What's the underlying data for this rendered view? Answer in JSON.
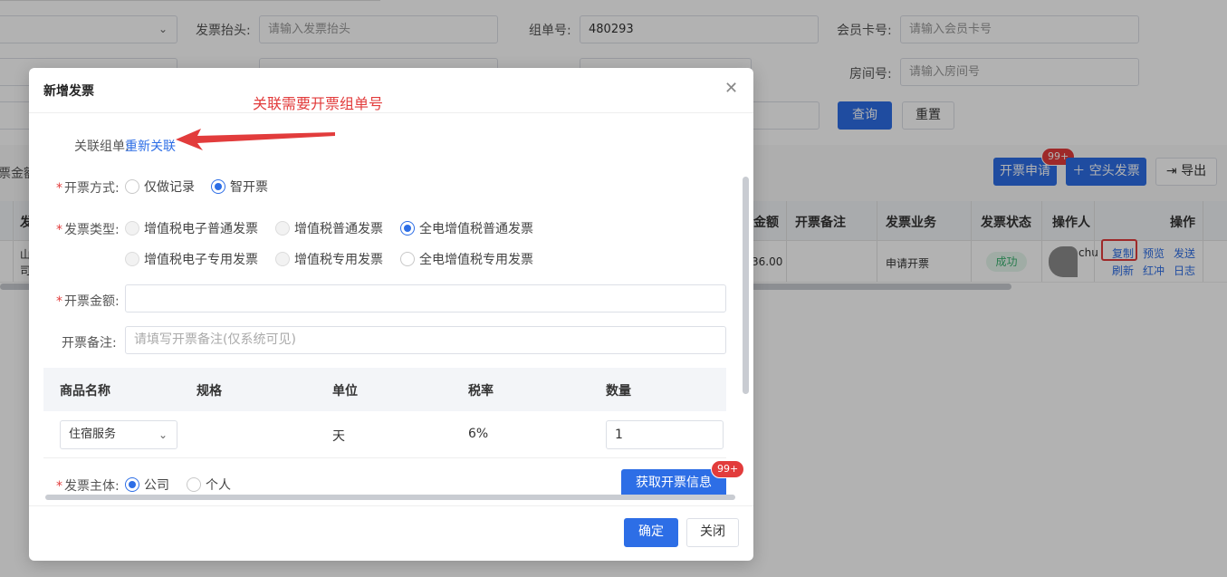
{
  "filters": {
    "invoice_title_label": "发票抬头:",
    "invoice_title_placeholder": "请输入发票抬头",
    "group_no_label": "组单号:",
    "group_no_value": "480293",
    "member_card_label": "会员卡号:",
    "member_card_placeholder": "请输入会员卡号",
    "room_no_label": "房间号:",
    "room_no_placeholder": "请输入房间号",
    "query_button": "查询",
    "reset_button": "重置"
  },
  "toolbar": {
    "amount_partial": "票金额",
    "apply_invoice": "开票申请",
    "apply_badge": "99+",
    "blank_invoice": "空头发票",
    "export": "导出"
  },
  "table": {
    "headers": {
      "first_partial": "发",
      "amount_partial": "金额",
      "note": "开票备注",
      "business": "发票业务",
      "status": "发票状态",
      "operator": "操作人",
      "actions": "操作"
    },
    "row": {
      "first_line1": "山",
      "first_line2": "司",
      "amount": "36.00",
      "business": "申请开票",
      "status": "成功",
      "operator_partial": "chu",
      "actions": [
        "复制",
        "预览",
        "发送",
        "刷新",
        "红冲",
        "日志"
      ]
    }
  },
  "modal": {
    "title": "新增发票",
    "related_order_label": "关联组单:",
    "related_order_link": "重新关联",
    "method_label": "开票方式:",
    "method_options": [
      "仅做记录",
      "智开票"
    ],
    "method_selected": "智开票",
    "type_label": "发票类型:",
    "type_options_row1": [
      "增值税电子普通发票",
      "增值税普通发票",
      "全电增值税普通发票"
    ],
    "type_options_row2": [
      "增值税电子专用发票",
      "增值税专用发票",
      "全电增值税专用发票"
    ],
    "type_selected": "全电增值税普通发票",
    "amount_label": "开票金额:",
    "amount_value": "",
    "remark_label": "开票备注:",
    "remark_placeholder": "请填写开票备注(仅系统可见)",
    "goods_table": {
      "headers": [
        "商品名称",
        "规格",
        "单位",
        "税率",
        "数量"
      ],
      "row": {
        "name": "住宿服务",
        "spec": "",
        "unit": "天",
        "tax_rate": "6%",
        "quantity": "1"
      }
    },
    "subject_label": "发票主体:",
    "subject_options": [
      "公司",
      "个人"
    ],
    "subject_selected": "公司",
    "fetch_info_button": "获取开票信息",
    "fetch_badge": "99+",
    "confirm_button": "确定",
    "close_button": "关闭"
  },
  "annotation": {
    "text": "关联需要开票组单号",
    "color": "#e23c3c"
  },
  "colors": {
    "primary": "#2d6ee6",
    "danger": "#e23c3c",
    "success": "#3cb371"
  }
}
